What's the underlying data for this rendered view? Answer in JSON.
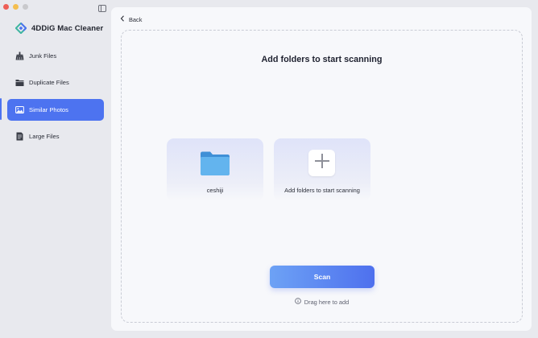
{
  "window": {
    "controls": [
      "close",
      "minimize",
      "zoom"
    ],
    "sidebar_toggle_icon": "sidebar-toggle-icon"
  },
  "app": {
    "name": "4DDiG Mac Cleaner",
    "logo_icon": "4ddig-logo-icon"
  },
  "sidebar": {
    "items": [
      {
        "label": "Junk Files",
        "icon": "broom-icon",
        "active": false
      },
      {
        "label": "Duplicate Files",
        "icon": "folder-stack-icon",
        "active": false
      },
      {
        "label": "Similar Photos",
        "icon": "photo-icon",
        "active": true
      },
      {
        "label": "Large Files",
        "icon": "large-file-icon",
        "active": false
      }
    ]
  },
  "main": {
    "back_label": "Back",
    "title": "Add folders to start scanning",
    "cards": [
      {
        "label": "ceshiji",
        "icon": "folder-icon"
      },
      {
        "label": "Add folders to start scanning",
        "icon": "plus-icon"
      }
    ],
    "scan_label": "Scan",
    "hint": "Drag here to add"
  },
  "colors": {
    "accent": "#4d73f0",
    "sidebar_bg": "#e8e9ee",
    "panel_bg": "#f7f8fb",
    "folder_blue": "#5aa9e6"
  }
}
